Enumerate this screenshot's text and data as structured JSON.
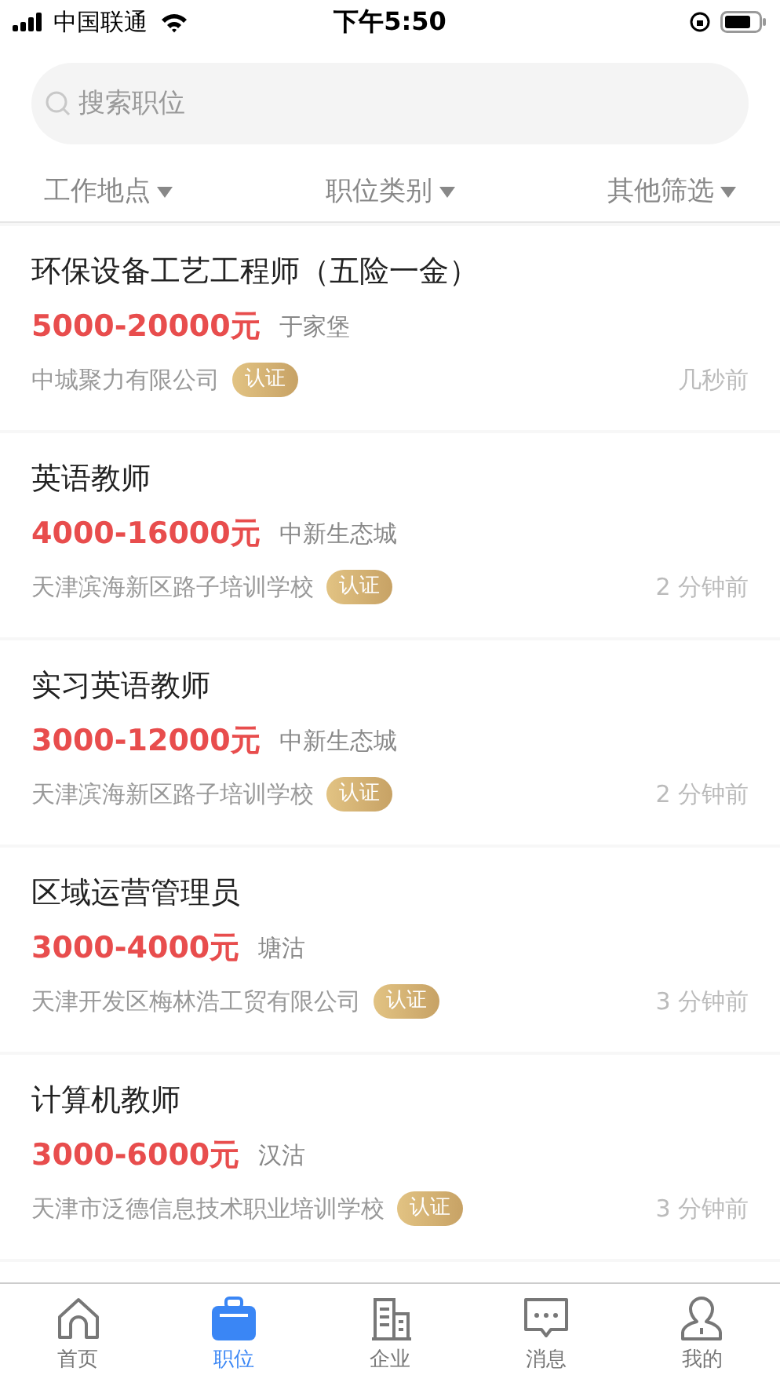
{
  "status_bar": {
    "carrier": "中国联通",
    "time": "下午5:50"
  },
  "search": {
    "placeholder": "搜索职位"
  },
  "filters": [
    {
      "label": "工作地点"
    },
    {
      "label": "职位类别"
    },
    {
      "label": "其他筛选"
    }
  ],
  "jobs": [
    {
      "title": "环保设备工艺工程师（五险一金）",
      "salary": "5000-20000元",
      "location": "于家堡",
      "company": "中城聚力有限公司",
      "badge": "认证",
      "time": "几秒前"
    },
    {
      "title": "英语教师",
      "salary": "4000-16000元",
      "location": "中新生态城",
      "company": "天津滨海新区路子培训学校",
      "badge": "认证",
      "time": "2 分钟前"
    },
    {
      "title": "实习英语教师",
      "salary": "3000-12000元",
      "location": "中新生态城",
      "company": "天津滨海新区路子培训学校",
      "badge": "认证",
      "time": "2 分钟前"
    },
    {
      "title": "区域运营管理员",
      "salary": "3000-4000元",
      "location": "塘沽",
      "company": "天津开发区梅林浩工贸有限公司",
      "badge": "认证",
      "time": "3 分钟前"
    },
    {
      "title": "计算机教师",
      "salary": "3000-6000元",
      "location": "汉沽",
      "company": "天津市泛德信息技术职业培训学校",
      "badge": "认证",
      "time": "3 分钟前"
    }
  ],
  "tab_bar": [
    {
      "kind": "home",
      "label": "首页",
      "selected": false
    },
    {
      "kind": "jobs",
      "label": "职位",
      "selected": true
    },
    {
      "kind": "company",
      "label": "企业",
      "selected": false
    },
    {
      "kind": "messages",
      "label": "消息",
      "selected": false
    },
    {
      "kind": "me",
      "label": "我的",
      "selected": false
    }
  ]
}
